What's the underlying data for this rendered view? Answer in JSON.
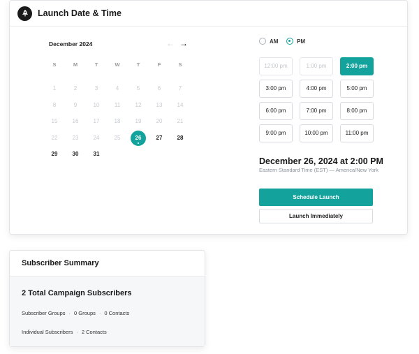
{
  "launch": {
    "title": "Launch Date & Time",
    "header_icon": "rocket-icon",
    "calendar": {
      "month_label": "December 2024",
      "prev_icon": "arrow-left-icon",
      "next_icon": "arrow-right-icon",
      "prev_glyph": "←",
      "next_glyph": "→",
      "weekdays": [
        "S",
        "M",
        "T",
        "W",
        "T",
        "F",
        "S"
      ],
      "selected_day": "26",
      "weeks": [
        [
          "1",
          "2",
          "3",
          "4",
          "5",
          "6",
          "7"
        ],
        [
          "8",
          "9",
          "10",
          "11",
          "12",
          "13",
          "14"
        ],
        [
          "15",
          "16",
          "17",
          "18",
          "19",
          "20",
          "21"
        ],
        [
          "22",
          "23",
          "24",
          "25",
          "26",
          "27",
          "28"
        ],
        [
          "29",
          "30",
          "31"
        ]
      ]
    },
    "period": {
      "am_label": "AM",
      "pm_label": "PM",
      "selected": "PM"
    },
    "time_slots": [
      {
        "label": "12:00 pm",
        "state": "disabled"
      },
      {
        "label": "1:00 pm",
        "state": "disabled"
      },
      {
        "label": "2:00 pm",
        "state": "active"
      },
      {
        "label": "3:00 pm",
        "state": "normal"
      },
      {
        "label": "4:00 pm",
        "state": "normal"
      },
      {
        "label": "5:00 pm",
        "state": "normal"
      },
      {
        "label": "6:00 pm",
        "state": "normal"
      },
      {
        "label": "7:00 pm",
        "state": "normal"
      },
      {
        "label": "8:00 pm",
        "state": "normal"
      },
      {
        "label": "9:00 pm",
        "state": "normal"
      },
      {
        "label": "10:00 pm",
        "state": "normal"
      },
      {
        "label": "11:00 pm",
        "state": "normal"
      }
    ],
    "selected_datetime": "December 26, 2024 at 2:00 PM",
    "timezone": "Eastern Standard Time (EST) — America/New York",
    "schedule_label": "Schedule Launch",
    "launch_now_label": "Launch Immediately"
  },
  "summary": {
    "title": "Subscriber Summary",
    "total": "2 Total Campaign Subscribers",
    "groups_label": "Subscriber Groups",
    "groups_count": "0 Groups",
    "groups_contacts": "0 Contacts",
    "individual_label": "Individual Subscribers",
    "individual_contacts": "2 Contacts",
    "separator": "·"
  },
  "colors": {
    "accent": "#13a39c",
    "dark": "#1a1a1a",
    "muted": "#c7cad0"
  }
}
